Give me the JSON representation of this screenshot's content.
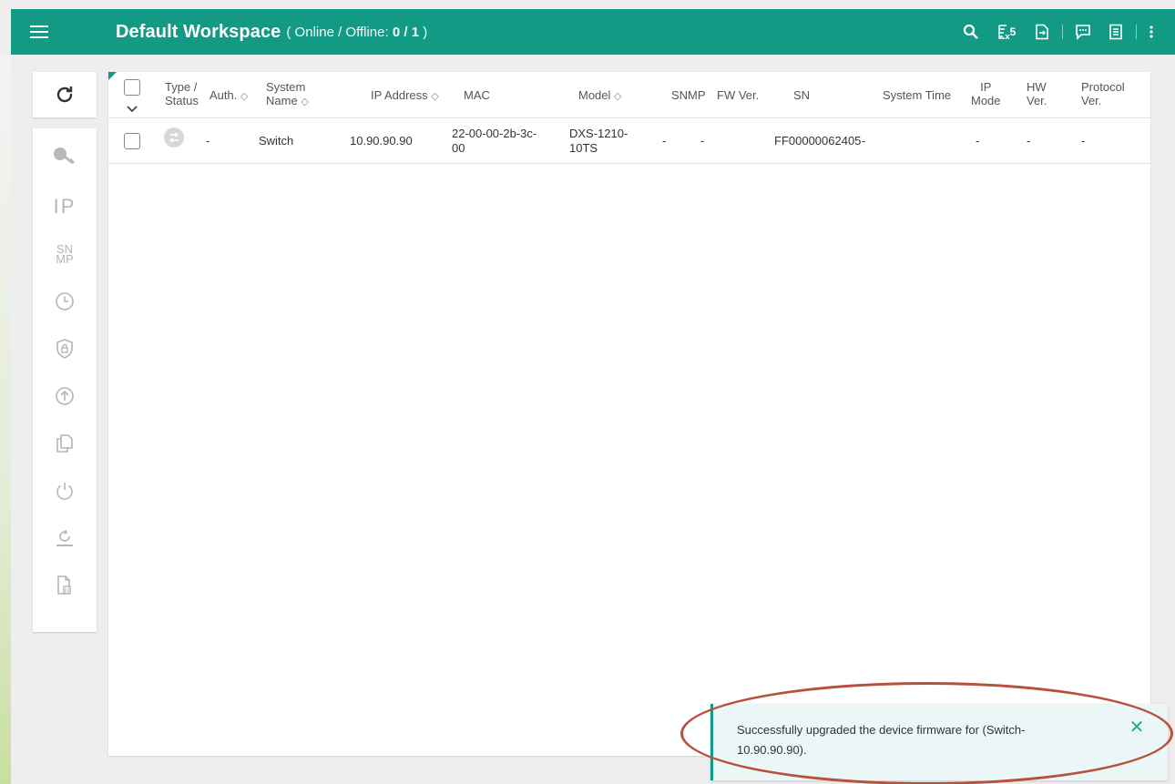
{
  "header": {
    "title": "Default Workspace",
    "status_open": "( Online / Offline: ",
    "status_counts": "0 / 1",
    "status_close": " )",
    "export_badge": "5"
  },
  "table": {
    "columns": {
      "type_status_1": "Type /",
      "type_status_2": "Status",
      "auth": "Auth.",
      "system_name_1": "System",
      "system_name_2": "Name",
      "ip_address": "IP Address",
      "mac": "MAC",
      "model": "Model",
      "snmp": "SNMP",
      "fw_ver": "FW Ver.",
      "sn": "SN",
      "system_time": "System Time",
      "ip_mode_1": "IP",
      "ip_mode_2": "Mode",
      "hw_ver_1": "HW",
      "hw_ver_2": "Ver.",
      "protocol_ver_1": "Protocol",
      "protocol_ver_2": "Ver."
    },
    "rows": [
      {
        "auth": "-",
        "system_name": "Switch",
        "ip_address": "10.90.90.90",
        "mac_1": "22-00-00-2b-3c-",
        "mac_2": "00",
        "model_1": "DXS-1210-",
        "model_2": "10TS",
        "snmp": "-",
        "fw_ver": "-",
        "sn": "FF00000062405",
        "system_time": "-",
        "ip_mode": "-",
        "hw_ver": "-",
        "protocol_ver": "-"
      }
    ]
  },
  "sidebar": {
    "ip_label": "IP",
    "snmp_label_1": "SN",
    "snmp_label_2": "MP"
  },
  "toast": {
    "message_1": "Successfully upgraded the device firmware for (Switch-",
    "message_2": "10.90.90.90)."
  },
  "colors": {
    "brand": "#139a84",
    "annotation": "#b8503c"
  }
}
